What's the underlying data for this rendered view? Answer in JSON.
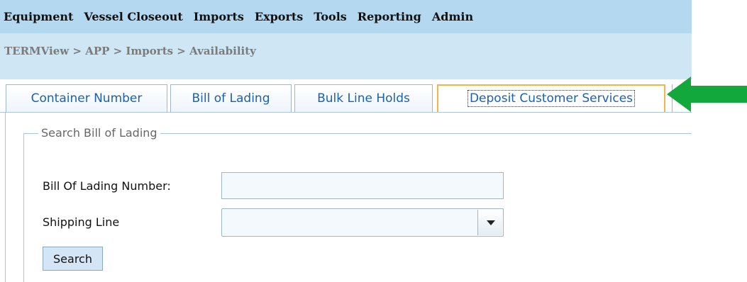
{
  "menu": {
    "items": [
      {
        "label": "Equipment"
      },
      {
        "label": "Vessel Closeout"
      },
      {
        "label": "Imports"
      },
      {
        "label": "Exports"
      },
      {
        "label": "Tools"
      },
      {
        "label": "Reporting"
      },
      {
        "label": "Admin"
      }
    ]
  },
  "breadcrumb": "TERMView > APP > Imports > Availability",
  "tabs": [
    {
      "label": "Container Number"
    },
    {
      "label": "Bill of Lading"
    },
    {
      "label": "Bulk Line Holds"
    },
    {
      "label": "Deposit Customer Services"
    }
  ],
  "form": {
    "legend": "Search Bill of Lading",
    "bol_label": "Bill Of Lading Number:",
    "bol_value": "",
    "shipping_line_label": "Shipping Line",
    "shipping_line_value": "",
    "search_label": "Search"
  },
  "colors": {
    "menu_bg": "#b4d8f0",
    "header_bg": "#cfe6f5",
    "tab_text": "#1c60b0",
    "active_tab_border": "#f0b64a",
    "arrow": "#12a83c"
  },
  "icons": {
    "dropdown": "chevron-down-icon",
    "pointer": "arrow-left-icon"
  }
}
